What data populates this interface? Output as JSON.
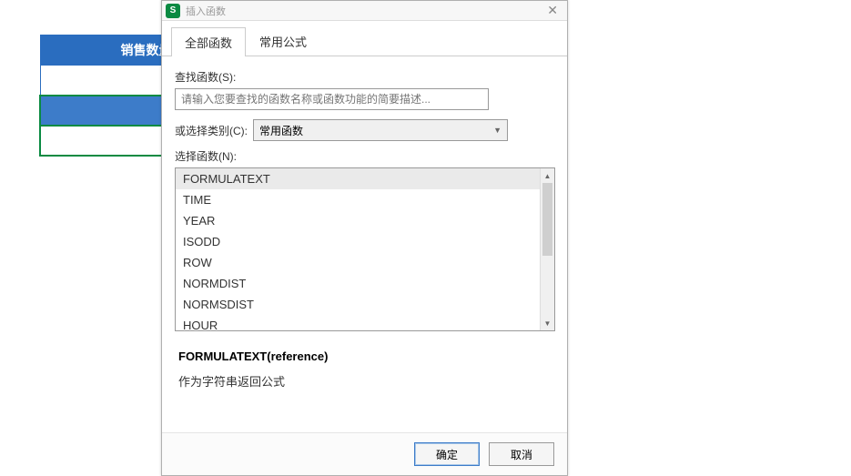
{
  "bgTable": {
    "header": "销售数量",
    "row1": "",
    "row2": "",
    "row3": ""
  },
  "dialog": {
    "title": "插入函数",
    "tabs": [
      "全部函数",
      "常用公式"
    ],
    "searchLabel": "查找函数(S):",
    "searchPlaceholder": "请输入您要查找的函数名称或函数功能的简要描述...",
    "categoryLabel": "或选择类别(C):",
    "categoryValue": "常用函数",
    "listLabel": "选择函数(N):",
    "functions": [
      "FORMULATEXT",
      "TIME",
      "YEAR",
      "ISODD",
      "ROW",
      "NORMDIST",
      "NORMSDIST",
      "HOUR"
    ],
    "signature": "FORMULATEXT(reference)",
    "description": "作为字符串返回公式",
    "ok": "确定",
    "cancel": "取消"
  }
}
